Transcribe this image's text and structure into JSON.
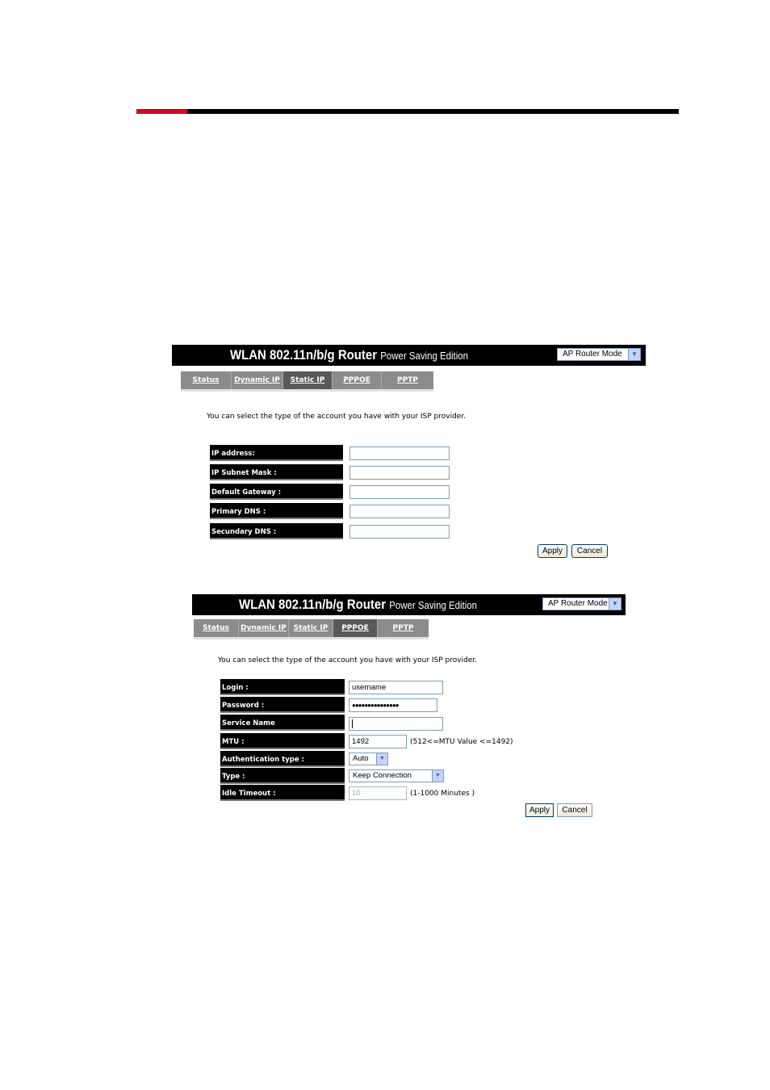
{
  "page": {
    "accent_color": "#d4001f"
  },
  "static_ip_panel": {
    "header": {
      "title": "WLAN 802.11n/b/g Router",
      "subtitle": "Power Saving Edition",
      "mode_select": "AP Router Mode"
    },
    "tabs": [
      {
        "label": "Status",
        "active": false
      },
      {
        "label": "Dynamic IP",
        "active": false
      },
      {
        "label": "Static IP",
        "active": true
      },
      {
        "label": "PPPOE",
        "active": false
      },
      {
        "label": "PPTP",
        "active": false
      }
    ],
    "intro": "You can select the type of the account you have with your ISP provider.",
    "fields": [
      {
        "label": "IP address:",
        "value": ""
      },
      {
        "label": "IP Subnet Mask :",
        "value": ""
      },
      {
        "label": "Default Gateway :",
        "value": ""
      },
      {
        "label": "Primary DNS :",
        "value": ""
      },
      {
        "label": "Secundary DNS :",
        "value": ""
      }
    ],
    "apply_label": "Apply",
    "cancel_label": "Cancel"
  },
  "pppoe_panel": {
    "header": {
      "title": "WLAN 802.11n/b/g Router",
      "subtitle": "Power Saving Edition",
      "mode_select": "AP Router Mode"
    },
    "tabs": [
      {
        "label": "Status",
        "active": false
      },
      {
        "label": "Dynamic IP",
        "active": false
      },
      {
        "label": "Static IP",
        "active": false
      },
      {
        "label": "PPPOE",
        "active": true
      },
      {
        "label": "PPTP",
        "active": false
      }
    ],
    "intro": "You can select the type of the account you have with your ISP provider.",
    "login": {
      "label": "Login :",
      "value": "username"
    },
    "password": {
      "label": "Password :",
      "value": "●●●●●●●●●●●●●●●"
    },
    "service_name": {
      "label": "Service Name",
      "value": ""
    },
    "mtu": {
      "label": "MTU :",
      "value": "1492",
      "hint": "(512<=MTU Value <=1492)"
    },
    "auth_type": {
      "label": "Authentication type :",
      "value": "Auto"
    },
    "type": {
      "label": "Type :",
      "value": "Keep Connection"
    },
    "idle_timeout": {
      "label": "Idle Timeout :",
      "value": "10",
      "hint": "(1-1000 Minutes )"
    },
    "apply_label": "Apply",
    "cancel_label": "Cancel"
  }
}
